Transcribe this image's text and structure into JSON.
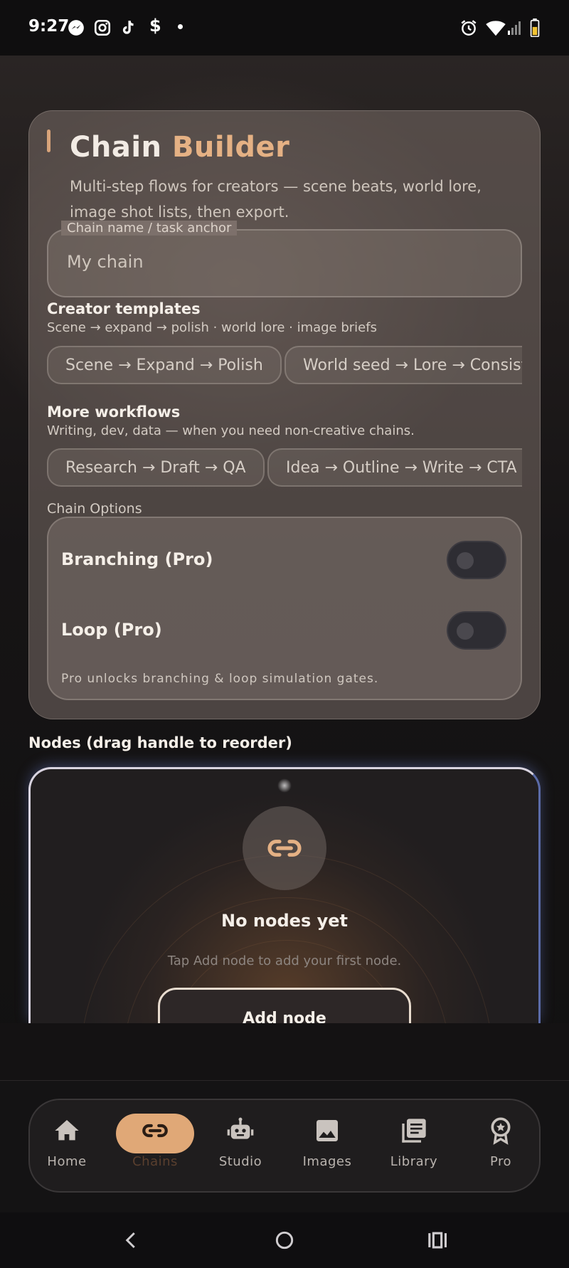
{
  "status_bar": {
    "time": "9:27",
    "left_icons": [
      "messenger-icon",
      "instagram-icon",
      "tiktok-icon",
      "cash-app-icon",
      "dot-icon"
    ],
    "right_icons": [
      "alarm-icon",
      "wifi-icon",
      "signal-icon",
      "battery-icon"
    ]
  },
  "header": {
    "title_main": "Chain ",
    "title_highlight": "Builder",
    "subtitle": "Multi-step flows for creators — scene beats, world lore, image shot lists, then export.",
    "accent_color": "#e5b184"
  },
  "chain_name": {
    "label": "Chain name / task anchor",
    "value": "My chain"
  },
  "creator_templates": {
    "title": "Creator templates",
    "description": "Scene → expand → polish · world lore · image briefs",
    "chips": [
      "Scene → Expand → Polish",
      "World seed → Lore → Consistency"
    ]
  },
  "more_workflows": {
    "title": "More workflows",
    "description": "Writing, dev, data — when you need non-creative chains.",
    "chips": [
      "Research → Draft → QA",
      "Idea → Outline → Write → CTA"
    ]
  },
  "chain_options": {
    "label": "Chain Options",
    "options": [
      {
        "label": "Branching (Pro)",
        "enabled": false
      },
      {
        "label": "Loop (Pro)",
        "enabled": false
      }
    ],
    "note": "Pro unlocks branching & loop simulation gates."
  },
  "nodes": {
    "title": "Nodes (drag handle to reorder)",
    "empty_title": "No nodes yet",
    "empty_desc": "Tap Add node to add your first node.",
    "add_button": "Add node"
  },
  "bottom_nav": {
    "active": "Chains",
    "active_color": "#e0a877",
    "items": [
      {
        "label": "Home",
        "icon": "home-icon"
      },
      {
        "label": "Chains",
        "icon": "link-icon"
      },
      {
        "label": "Studio",
        "icon": "robot-icon"
      },
      {
        "label": "Images",
        "icon": "image-icon"
      },
      {
        "label": "Library",
        "icon": "library-icon"
      },
      {
        "label": "Pro",
        "icon": "badge-star-icon"
      }
    ]
  },
  "system_nav": [
    "back-icon",
    "home-circle-icon",
    "recents-icon"
  ]
}
